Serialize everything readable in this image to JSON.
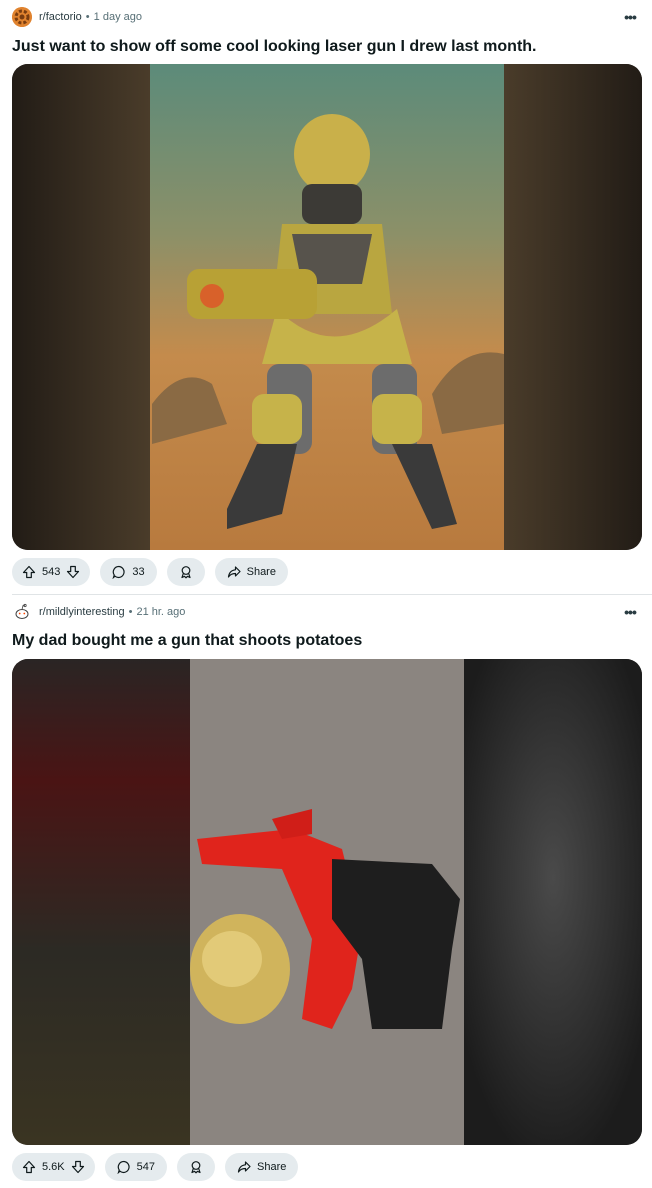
{
  "posts": [
    {
      "subreddit": "r/factorio",
      "time": "1 day ago",
      "more_label": "•••",
      "title": "Just want to show off some cool looking laser gun I drew last month.",
      "upvotes": "543",
      "comments": "33",
      "share_label": "Share"
    },
    {
      "subreddit": "r/mildlyinteresting",
      "time": "21 hr. ago",
      "more_label": "•••",
      "title": "My dad bought me a gun that shoots potatoes",
      "upvotes": "5.6K",
      "comments": "547",
      "share_label": "Share"
    }
  ],
  "separator": "•",
  "colors": {
    "pill_bg": "#e5ebee",
    "meta_text": "#576f76",
    "factorio_orange": "#e0832f"
  },
  "icons": [
    "factorio-avatar-icon",
    "reddit-alien-avatar-icon",
    "upvote-icon",
    "downvote-icon",
    "comment-icon",
    "award-icon",
    "share-icon"
  ]
}
